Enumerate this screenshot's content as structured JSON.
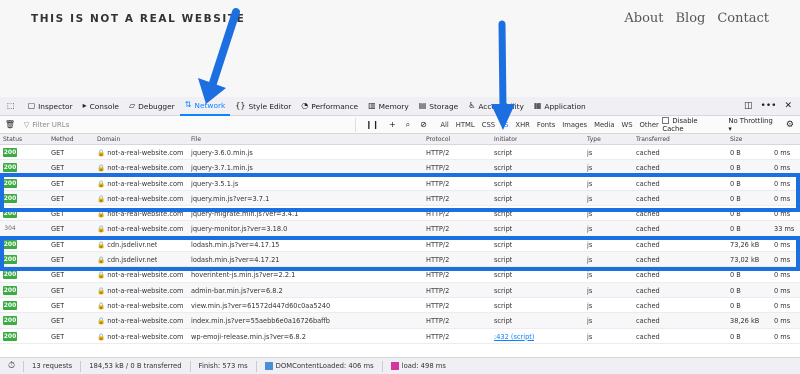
{
  "site": {
    "brand": "THIS IS NOT A REAL WEBSITE",
    "nav": [
      "About",
      "Blog",
      "Contact"
    ]
  },
  "devtools": {
    "tabs": [
      {
        "label": "Inspector",
        "icon": "inspector-icon",
        "glyph": "▢"
      },
      {
        "label": "Console",
        "icon": "console-icon",
        "glyph": "▸"
      },
      {
        "label": "Debugger",
        "icon": "debugger-icon",
        "glyph": "▱"
      },
      {
        "label": "Network",
        "icon": "network-icon",
        "glyph": "⇅",
        "active": true
      },
      {
        "label": "Style Editor",
        "icon": "style-editor-icon",
        "glyph": "{}"
      },
      {
        "label": "Performance",
        "icon": "performance-icon",
        "glyph": "◔"
      },
      {
        "label": "Memory",
        "icon": "memory-icon",
        "glyph": "▥"
      },
      {
        "label": "Storage",
        "icon": "storage-icon",
        "glyph": "▤"
      },
      {
        "label": "Accessibility",
        "icon": "accessibility-icon",
        "glyph": "♿"
      },
      {
        "label": "Application",
        "icon": "application-icon",
        "glyph": "▦"
      }
    ],
    "filter_placeholder": "Filter URLs",
    "type_filters": [
      "All",
      "HTML",
      "CSS",
      "JS",
      "XHR",
      "Fonts",
      "Images",
      "Media",
      "WS",
      "Other"
    ],
    "active_type": "JS",
    "disable_cache_label": "Disable Cache",
    "throttling": "No Throttling ▾",
    "columns": {
      "status": "Status",
      "method": "Method",
      "domain": "Domain",
      "file": "File",
      "protocol": "Protocol",
      "initiator": "Initiator",
      "type": "Type",
      "transferred": "Transferred",
      "size": "Size"
    },
    "requests": [
      {
        "status": "200",
        "method": "GET",
        "domain": "not-a-real-website.com",
        "file": "jquery-3.6.0.min.js",
        "protocol": "HTTP/2",
        "initiator": "script",
        "type": "js",
        "transferred": "cached",
        "size": "0 B",
        "time": "0 ms"
      },
      {
        "status": "200",
        "method": "GET",
        "domain": "not-a-real-website.com",
        "file": "jquery-3.7.1.min.js",
        "protocol": "HTTP/2",
        "initiator": "script",
        "type": "js",
        "transferred": "cached",
        "size": "0 B",
        "time": "0 ms"
      },
      {
        "status": "200",
        "method": "GET",
        "domain": "not-a-real-website.com",
        "file": "jquery-3.5.1.js",
        "protocol": "HTTP/2",
        "initiator": "script",
        "type": "js",
        "transferred": "cached",
        "size": "0 B",
        "time": "0 ms"
      },
      {
        "status": "200",
        "method": "GET",
        "domain": "not-a-real-website.com",
        "file": "jquery.min.js?ver=3.7.1",
        "protocol": "HTTP/2",
        "initiator": "script",
        "type": "js",
        "transferred": "cached",
        "size": "0 B",
        "time": "0 ms"
      },
      {
        "status": "200",
        "method": "GET",
        "domain": "not-a-real-website.com",
        "file": "jquery-migrate.min.js?ver=3.4.1",
        "protocol": "HTTP/2",
        "initiator": "script",
        "type": "js",
        "transferred": "cached",
        "size": "0 B",
        "time": "0 ms"
      },
      {
        "status": "304",
        "method": "GET",
        "domain": "not-a-real-website.com",
        "file": "jquery-monitor.js?ver=3.18.0",
        "protocol": "HTTP/2",
        "initiator": "script",
        "type": "js",
        "transferred": "cached",
        "size": "0 B",
        "time": "33 ms"
      },
      {
        "status": "200",
        "method": "GET",
        "domain": "cdn.jsdelivr.net",
        "file": "lodash.min.js?ver=4.17.15",
        "protocol": "HTTP/2",
        "initiator": "script",
        "type": "js",
        "transferred": "cached",
        "size": "73,26 kB",
        "time": "0 ms"
      },
      {
        "status": "200",
        "method": "GET",
        "domain": "cdn.jsdelivr.net",
        "file": "lodash.min.js?ver=4.17.21",
        "protocol": "HTTP/2",
        "initiator": "script",
        "type": "js",
        "transferred": "cached",
        "size": "73,02 kB",
        "time": "0 ms"
      },
      {
        "status": "200",
        "method": "GET",
        "domain": "not-a-real-website.com",
        "file": "hoverintent-js.min.js?ver=2.2.1",
        "protocol": "HTTP/2",
        "initiator": "script",
        "type": "js",
        "transferred": "cached",
        "size": "0 B",
        "time": "0 ms"
      },
      {
        "status": "200",
        "method": "GET",
        "domain": "not-a-real-website.com",
        "file": "admin-bar.min.js?ver=6.8.2",
        "protocol": "HTTP/2",
        "initiator": "script",
        "type": "js",
        "transferred": "cached",
        "size": "0 B",
        "time": "0 ms"
      },
      {
        "status": "200",
        "method": "GET",
        "domain": "not-a-real-website.com",
        "file": "view.min.js?ver=61572d447d60c0aa5240",
        "protocol": "HTTP/2",
        "initiator": "script",
        "type": "js",
        "transferred": "cached",
        "size": "0 B",
        "time": "0 ms"
      },
      {
        "status": "200",
        "method": "GET",
        "domain": "not-a-real-website.com",
        "file": "index.min.js?ver=55aebb6e0a16726baffb",
        "protocol": "HTTP/2",
        "initiator": "script",
        "type": "js",
        "transferred": "cached",
        "size": "38,26 kB",
        "time": "0 ms"
      },
      {
        "status": "200",
        "method": "GET",
        "domain": "not-a-real-website.com",
        "file": "wp-emoji-release.min.js?ver=6.8.2",
        "protocol": "HTTP/2",
        "initiator": ":432 (script)",
        "type": "js",
        "transferred": "cached",
        "size": "0 B",
        "time": "0 ms"
      }
    ],
    "statusbar": {
      "requests": "13 requests",
      "transferred": "184,53 kB / 0 B transferred",
      "finish": "Finish: 573 ms",
      "dcl": "DOMContentLoaded: 406 ms",
      "load": "load: 498 ms"
    }
  }
}
